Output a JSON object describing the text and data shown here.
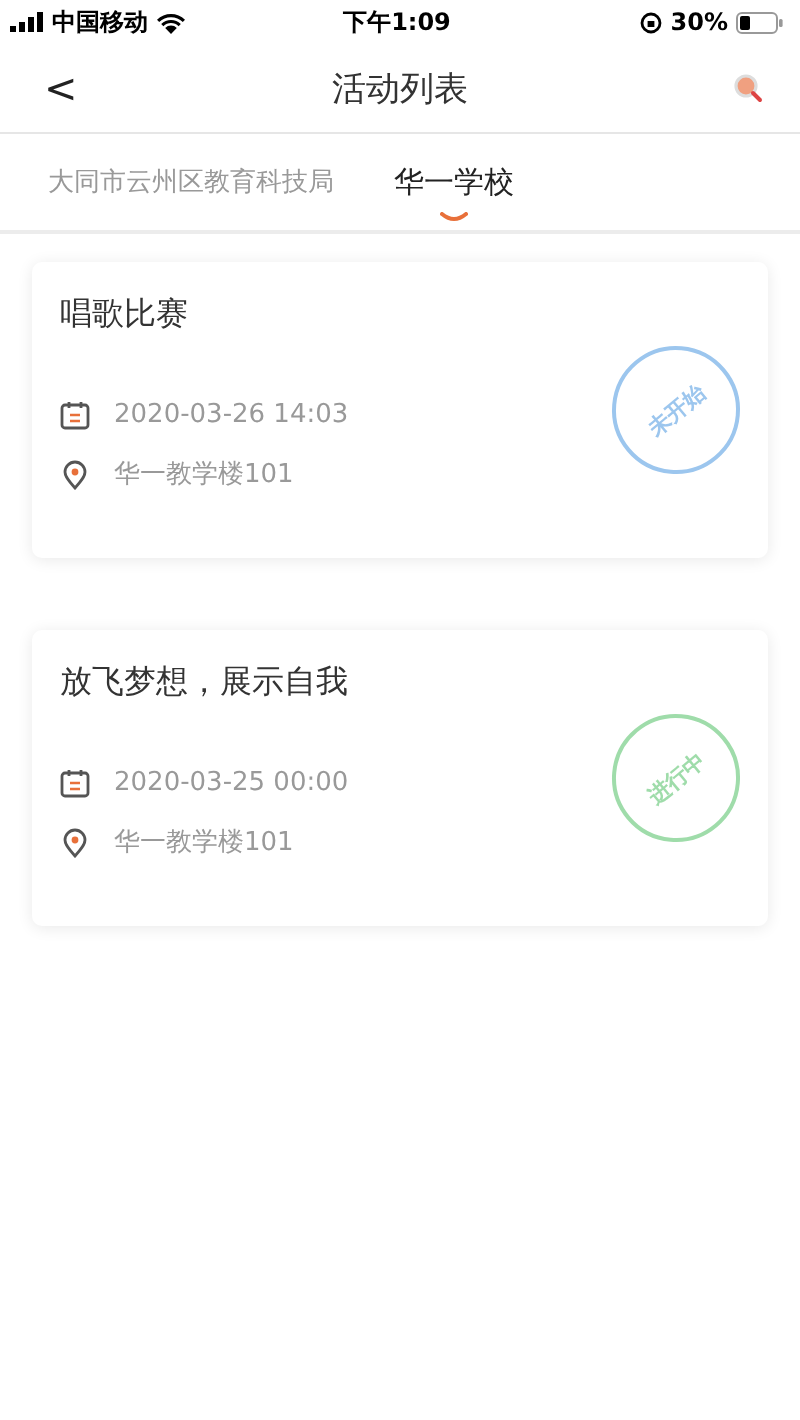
{
  "status_bar": {
    "carrier": "中国移动",
    "time": "下午1:09",
    "battery": "30%"
  },
  "nav": {
    "back": "<",
    "title": "活动列表"
  },
  "tabs": [
    {
      "label": "大同市云州区教育科技局",
      "selected": false
    },
    {
      "label": "华一学校",
      "selected": true
    }
  ],
  "activities": [
    {
      "title": "唱歌比赛",
      "datetime": "2020-03-26 14:03",
      "location": "华一教学楼101",
      "stamp": "未开始",
      "color": "#9cc6ee"
    },
    {
      "title": "放飞梦想，展示自我",
      "datetime": "2020-03-25 00:00",
      "location": "华一教学楼101",
      "stamp": "进行中",
      "color": "#9fdcaa"
    }
  ]
}
